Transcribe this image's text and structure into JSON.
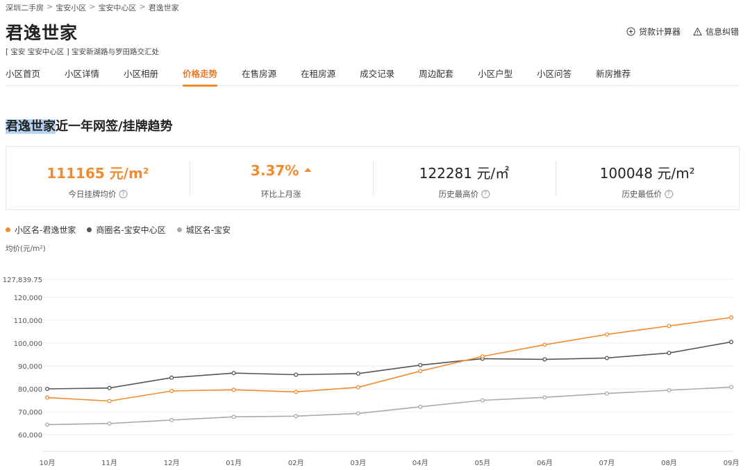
{
  "breadcrumb": [
    "深圳二手房",
    "宝安小区",
    "宝安中心区",
    "君逸世家"
  ],
  "breadcrumb_sep": ">",
  "page_title": "君逸世家",
  "header_tools": {
    "loan_calc": "贷款计算器",
    "report_error": "信息纠错"
  },
  "address": "[ 宝安  宝安中心区 ] 宝安新湖路与罗田路交汇处",
  "tabs": [
    "小区首页",
    "小区详情",
    "小区相册",
    "价格走势",
    "在售房源",
    "在租房源",
    "成交记录",
    "周边配套",
    "小区户型",
    "小区问答",
    "新房推荐"
  ],
  "active_tab": "价格走势",
  "section_title": {
    "highlight": "君逸世家",
    "rest": "近一年网签/挂牌趋势"
  },
  "stats": {
    "listing_avg": {
      "value": "111165 元/m²",
      "label": "今日挂牌均价"
    },
    "mom_change": {
      "value": "3.37%",
      "label": "环比上月涨",
      "direction": "up"
    },
    "hist_high": {
      "value": "122281 元/㎡",
      "label": "历史最高价"
    },
    "hist_low": {
      "value": "100048 元/m²",
      "label": "历史最低价"
    }
  },
  "help_glyph": "?",
  "colors": {
    "accent": "#f28a2e",
    "community": "#f28a2e",
    "business_district": "#555555",
    "city_district": "#aaaaaa"
  },
  "chart_data": {
    "type": "line",
    "ylabel": "均价(元/m²)",
    "categories": [
      "10月",
      "11月",
      "12月",
      "01月",
      "02月",
      "03月",
      "04月",
      "05月",
      "06月",
      "07月",
      "08月",
      "09月"
    ],
    "ylim": [
      57000,
      127839.75
    ],
    "yticks": [
      60000,
      70000,
      80000,
      90000,
      100000,
      110000,
      120000,
      127839.75
    ],
    "ytick_labels": [
      "60,000",
      "70,000",
      "80,000",
      "90,000",
      "100,000",
      "110,000",
      "120,000",
      "127,839.75"
    ],
    "grid": true,
    "legend_position": "top-left",
    "series": [
      {
        "name": "小区名-君逸世家",
        "color": "#f28a2e",
        "values": [
          76200,
          74700,
          79100,
          79600,
          78700,
          80700,
          87800,
          94200,
          99300,
          103800,
          107500,
          111200
        ]
      },
      {
        "name": "商圈名-宝安中心区",
        "color": "#555555",
        "values": [
          80000,
          80400,
          84900,
          86900,
          86200,
          86700,
          90400,
          93200,
          92900,
          93500,
          95700,
          100500
        ]
      },
      {
        "name": "城区名-宝安",
        "color": "#aaaaaa",
        "values": [
          64400,
          64900,
          66400,
          67800,
          68100,
          69300,
          72200,
          75000,
          76300,
          78000,
          79400,
          80800
        ]
      }
    ]
  }
}
